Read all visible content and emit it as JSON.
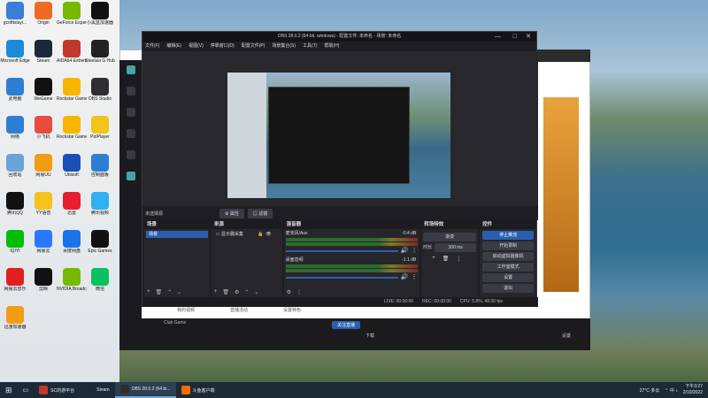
{
  "desktop": {
    "icons": [
      {
        "label": "gcofttslayi...",
        "color": "#3b7dd8"
      },
      {
        "label": "Origin",
        "color": "#f06a21"
      },
      {
        "label": "GeForce Experience",
        "color": "#76b900"
      },
      {
        "label": "小黑盒加速器",
        "color": "#111111"
      },
      {
        "label": "Microsoft Edge",
        "color": "#1c8bd6"
      },
      {
        "label": "Steam",
        "color": "#1b2838"
      },
      {
        "label": "AIDA64 Extreme",
        "color": "#c0392b"
      },
      {
        "label": "Steelsia G Hub",
        "color": "#222222"
      },
      {
        "label": "此电脑",
        "color": "#2d7fd3"
      },
      {
        "label": "WeGame",
        "color": "#111111"
      },
      {
        "label": "Rockstar Games",
        "color": "#f7b500"
      },
      {
        "label": "OBS Studio",
        "color": "#302e31"
      },
      {
        "label": "网络",
        "color": "#2d7fd3"
      },
      {
        "label": "小飞机",
        "color": "#e74c3c"
      },
      {
        "label": "Rockstar Games",
        "color": "#f7b500"
      },
      {
        "label": "PotPlayer",
        "color": "#f0c419"
      },
      {
        "label": "回收站",
        "color": "#6aa3d9"
      },
      {
        "label": "网易UU",
        "color": "#f39c12"
      },
      {
        "label": "Ubisoft",
        "color": "#1a4fb8"
      },
      {
        "label": "控制面板",
        "color": "#2d7fd3"
      },
      {
        "label": "腾讯QQ",
        "color": "#111111"
      },
      {
        "label": "YY语音",
        "color": "#f4c21b"
      },
      {
        "label": "迅雷",
        "color": "#e61e2f"
      },
      {
        "label": "腾讯视频",
        "color": "#30b0f0"
      },
      {
        "label": "iQIYI",
        "color": "#00be06"
      },
      {
        "label": "网易云",
        "color": "#2979ff"
      },
      {
        "label": "百度网盘",
        "color": "#1a73e8"
      },
      {
        "label": "Epic Games",
        "color": "#111111"
      },
      {
        "label": "网易云音乐",
        "color": "#e02020"
      },
      {
        "label": "剪映",
        "color": "#111111"
      },
      {
        "label": "NVIDIA Broadcast",
        "color": "#76b900"
      },
      {
        "label": "微信",
        "color": "#07c160"
      },
      {
        "label": "迅游加速器",
        "color": "#f39c12"
      }
    ]
  },
  "obs": {
    "title": "OBS 28.0.2 (64-bit, windows) - 配置文件: 未命名 - 场景: 未命名",
    "menu": [
      "文件(F)",
      "编辑(E)",
      "视图(V)",
      "停靠窗口(D)",
      "配置文件(P)",
      "场景集合(S)",
      "工具(T)",
      "帮助(H)"
    ],
    "preview_label": "未选择源",
    "props_btn": "属性",
    "filters_btn": "滤镜",
    "scenes_title": "场景",
    "scenes": [
      "场景"
    ],
    "sources_title": "来源",
    "sources": [
      "显示器采集"
    ],
    "mixer_title": "混音器",
    "mixer": [
      {
        "name": "麦克风/Aux",
        "db": "-0.4 dB"
      },
      {
        "name": "桌面音频",
        "db": "-1.1 dB"
      }
    ],
    "transitions_title": "转场特效",
    "transition_type": "渐变",
    "duration_label": "时长",
    "duration": "300 ms",
    "controls_title": "控件",
    "controls": [
      "停止推流",
      "开始录制",
      "启动虚拟摄像机",
      "工作室模式",
      "设置",
      "退出"
    ],
    "status": {
      "live": "LIVE: 00:00:00",
      "rec": "REC: 00:00:00",
      "cpu": "CPU: 5.8%, 48.00 fps"
    }
  },
  "background_app": {
    "footer_text_1": "我的视频",
    "footer_text_2": "直播活动",
    "footer_text_3": "设置特色",
    "game_label": "Club Game",
    "follow_btn": "关注直播",
    "bottom_label": "下载",
    "settings_label": "设置"
  },
  "taskbar": {
    "items": [
      {
        "label": "SC的游平台",
        "active": false,
        "color": "#c0392b"
      },
      {
        "label": "Steam",
        "active": false,
        "color": "#1b2838"
      },
      {
        "label": "OBS 28.0.2 (64 bi...",
        "active": true,
        "color": "#302e31"
      },
      {
        "label": "斗鱼客户端",
        "active": false,
        "color": "#ff6a00"
      }
    ],
    "weather": "27°C 多云",
    "time": "下午3:27",
    "date": "2/10/2022"
  }
}
